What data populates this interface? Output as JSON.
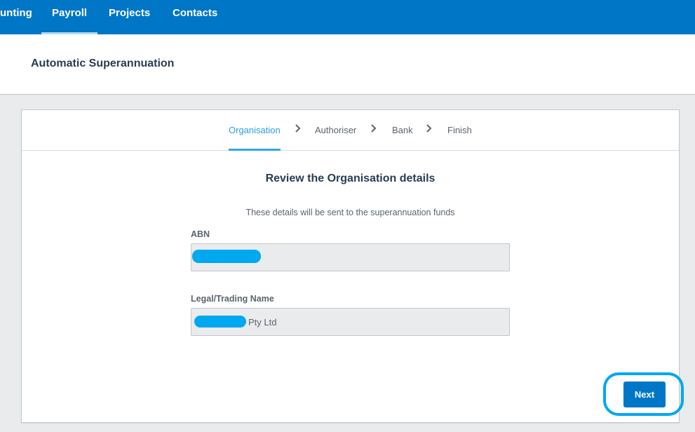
{
  "topnav": {
    "items": [
      {
        "label": "unting",
        "active": false
      },
      {
        "label": "Payroll",
        "active": true
      },
      {
        "label": "Projects",
        "active": false
      },
      {
        "label": "Contacts",
        "active": false
      }
    ]
  },
  "header": {
    "title": "Automatic Superannuation"
  },
  "stepper": {
    "steps": [
      {
        "label": "Organisation",
        "active": true
      },
      {
        "label": "Authoriser",
        "active": false
      },
      {
        "label": "Bank",
        "active": false
      },
      {
        "label": "Finish",
        "active": false
      }
    ],
    "separator_icon": "chevron-right-icon"
  },
  "form": {
    "title": "Review the Organisation details",
    "subtitle": "These details will be sent to the superannuation funds",
    "fields": [
      {
        "label": "ABN",
        "value": "",
        "redacted": true
      },
      {
        "label": "Legal/Trading Name",
        "value": "Pty Ltd",
        "redacted": true
      }
    ]
  },
  "actions": {
    "next_label": "Next"
  },
  "colors": {
    "nav_bg": "#0076c7",
    "accent": "#2a9fe0",
    "primary_button": "#0076c7",
    "highlight_ring": "#00a8f0",
    "redaction": "#00a8f0"
  }
}
